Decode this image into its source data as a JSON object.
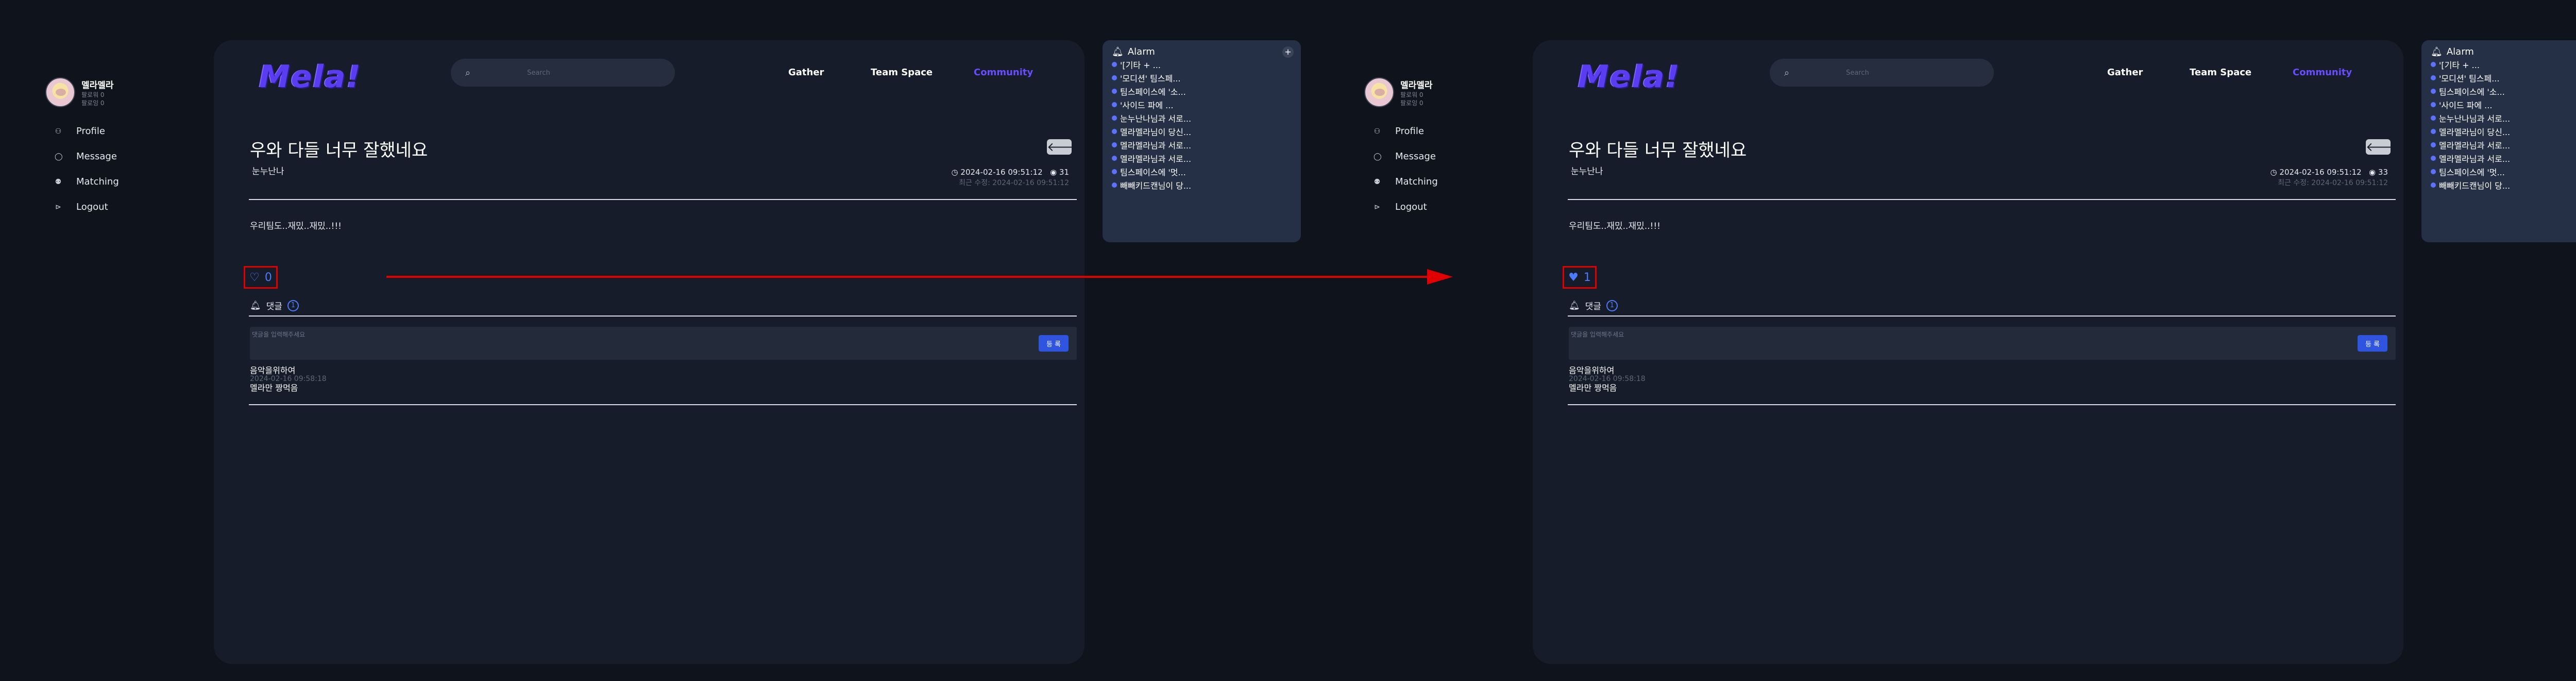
{
  "panels": [
    {
      "sidebar": {
        "name": "멜라멜라",
        "sub1": "팔로워 0",
        "sub2": "팔로잉 0",
        "nav": [
          "Profile",
          "Message",
          "Matching",
          "Logout"
        ]
      },
      "header": {
        "logo": "Mela!",
        "search_placeholder": "Search",
        "nav": [
          "Gather",
          "Team Space",
          "Community"
        ]
      },
      "post": {
        "title": "우와 다들 너무 잘했네요",
        "back": "🡐",
        "author": "눈누난나",
        "date": "2024-02-16 09:51:12",
        "views": "31",
        "updated": "최근 수정: 2024-02-16 09:51:12",
        "content": "우리팀도..재밌..재밌..!!!",
        "like_icon": "♡",
        "likes": "0",
        "comment_label": "댓글",
        "comment_count": "1",
        "comment_placeholder": "댓글을 입력해주세요",
        "submit": "등 록",
        "comment": {
          "author": "음악을위하여",
          "date": "2024-02-16 09:58:18",
          "text": "멜라만 짱먹음"
        }
      },
      "alarm": {
        "title": "Alarm",
        "plus": "+",
        "items": [
          "'[기타 + ...",
          "'모디션' 팀스페...",
          "팀스페이스에 '소...",
          "'사이드 파에 ...",
          "눈누난나님과 서로...",
          "멜라멜라님이 당신...",
          "멜라멜라님과 서로...",
          "멜라멜라님과 서로...",
          "팀스페이스에 '멋...",
          "빼빼키드캔님이 당..."
        ]
      }
    },
    {
      "sidebar": {
        "name": "멜라멜라",
        "sub1": "팔로워 0",
        "sub2": "팔로잉 0",
        "nav": [
          "Profile",
          "Message",
          "Matching",
          "Logout"
        ]
      },
      "header": {
        "logo": "Mela!",
        "search_placeholder": "Search",
        "nav": [
          "Gather",
          "Team Space",
          "Community"
        ]
      },
      "post": {
        "title": "우와 다들 너무 잘했네요",
        "back": "🡐",
        "author": "눈누난나",
        "date": "2024-02-16 09:51:12",
        "views": "33",
        "updated": "최근 수정: 2024-02-16 09:51:12",
        "content": "우리팀도..재밌..재밌..!!!",
        "like_icon": "♥",
        "likes": "1",
        "comment_label": "댓글",
        "comment_count": "1",
        "comment_placeholder": "댓글을 입력해주세요",
        "submit": "등 록",
        "comment": {
          "author": "음악을위하여",
          "date": "2024-02-16 09:58:18",
          "text": "멜라만 짱먹음"
        }
      },
      "alarm": {
        "title": "Alarm",
        "plus": "+",
        "items": [
          "'[기타 + ...",
          "'모디션' 팀스페...",
          "팀스페이스에 '소...",
          "'사이드 파에 ...",
          "눈누난나님과 서로...",
          "멜라멜라님이 당신...",
          "멜라멜라님과 서로...",
          "멜라멜라님과 서로...",
          "팀스페이스에 '멋...",
          "빼빼키드캔님이 당..."
        ]
      }
    }
  ],
  "colors": {
    "accent": "#6b4cff",
    "like": "#4c7bff",
    "highlight": "#e00000",
    "bg": "#0f131c",
    "card": "#161c2a"
  }
}
